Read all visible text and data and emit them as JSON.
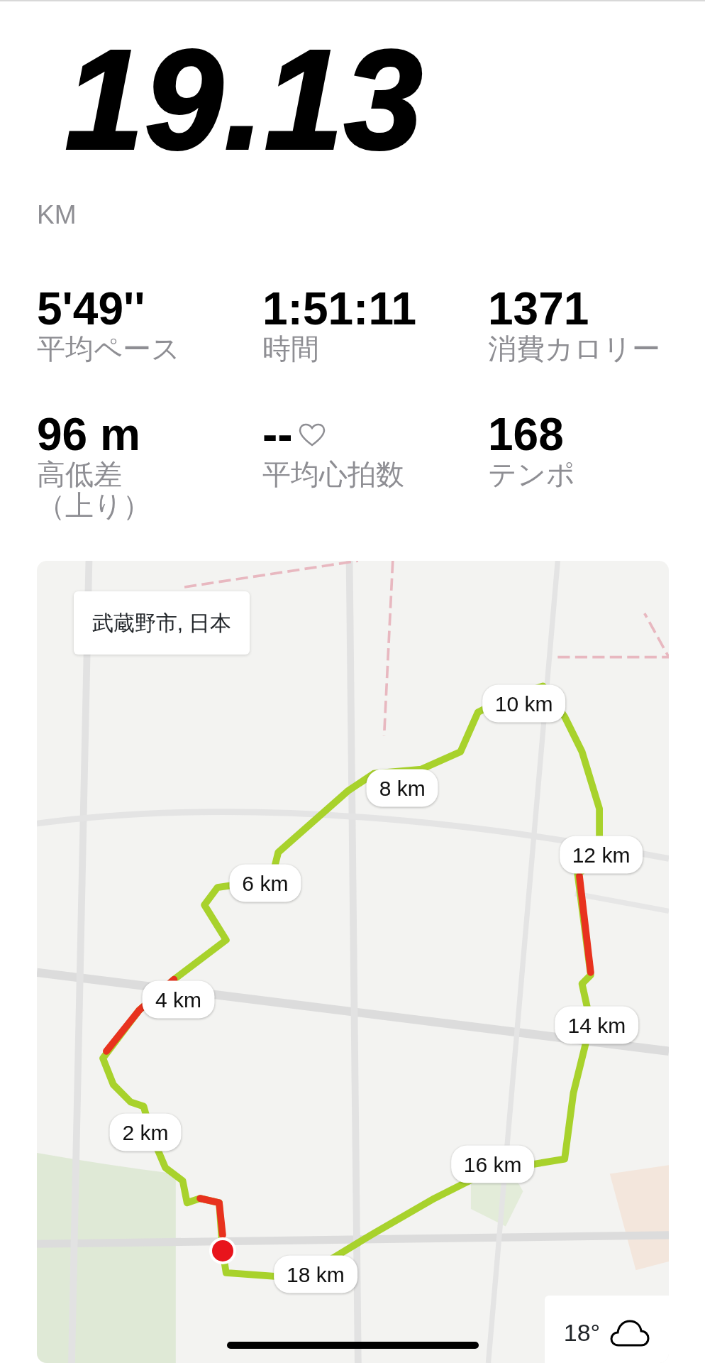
{
  "summary": {
    "distance": "19.13",
    "unit": "KM"
  },
  "stats": [
    {
      "value": "5'49''",
      "label": "平均ペース",
      "kind": "plain"
    },
    {
      "value": "1:51:11",
      "label": "時間",
      "kind": "plain"
    },
    {
      "value": "1371",
      "label": "消費カロリー",
      "kind": "plain"
    },
    {
      "value": "96 m",
      "label_lines": [
        "高低差",
        "（上り）"
      ],
      "kind": "plain"
    },
    {
      "value": "--",
      "label": "平均心拍数",
      "kind": "heart"
    },
    {
      "value": "168",
      "label": "テンポ",
      "kind": "plain"
    }
  ],
  "map": {
    "location": "武蔵野市, 日本",
    "markers": [
      {
        "label": "10 km"
      },
      {
        "label": "8 km"
      },
      {
        "label": "12 km"
      },
      {
        "label": "6 km"
      },
      {
        "label": "4 km"
      },
      {
        "label": "14 km"
      },
      {
        "label": "2 km"
      },
      {
        "label": "16 km"
      },
      {
        "label": "18 km"
      }
    ],
    "weather": {
      "temperature": "18°"
    }
  }
}
